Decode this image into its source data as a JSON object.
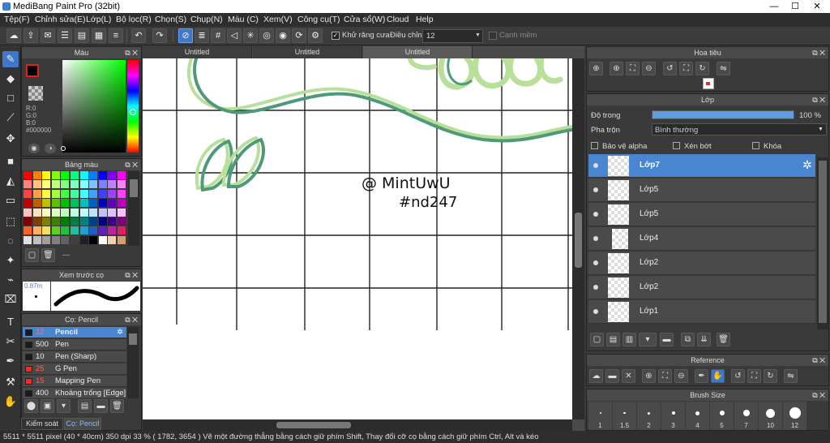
{
  "window": {
    "title": "MediBang Paint Pro (32bit)"
  },
  "menu": [
    "Tệp(F)",
    "Chỉnh sửa(E)",
    "Lớp(L)",
    "Bộ lọc(R)",
    "Chọn(S)",
    "Chụp(N)",
    "Màu (C)",
    "Xem(V)",
    "Công cụ(T)",
    "Cửa sổ(W)",
    "Cloud",
    "Help"
  ],
  "toolbar": {
    "antialias_label": "Khử răng cưa",
    "correction_label": "Điều chỉnh",
    "correction_value": "12",
    "smooth_label": "Cạnh mềm"
  },
  "color_panel": {
    "title": "Màu",
    "r": "R:0",
    "g": "G:0",
    "b": "B:0",
    "hex": "#000000"
  },
  "palette_panel": {
    "title": "Bảng màu",
    "footer": "---"
  },
  "preview_panel": {
    "title": "Xem trước cọ",
    "size": "0.87m"
  },
  "brush_panel": {
    "title": "Cọ: Pencil",
    "brushes": [
      {
        "size": "12",
        "name": "Pencil",
        "color": "#1a1a1a",
        "selected": true
      },
      {
        "size": "500",
        "name": "Pen",
        "color": "#1a1a1a",
        "selected": false
      },
      {
        "size": "10",
        "name": "Pen (Sharp)",
        "color": "#1a1a1a",
        "selected": false
      },
      {
        "size": "25",
        "name": "G Pen",
        "color": "#e03030",
        "selected": false
      },
      {
        "size": "15",
        "name": "Mapping Pen",
        "color": "#e03030",
        "selected": false
      },
      {
        "size": "400",
        "name": "Khoảng trống [Edge]",
        "color": "#1a1a1a",
        "selected": false
      }
    ],
    "tabs": [
      "Kiểm soát co",
      "Cọ: Pencil"
    ]
  },
  "canvas": {
    "tabs": [
      "Untitled",
      "Untitled",
      "Untitled"
    ],
    "watermark_line1": "@ MintUwU",
    "watermark_line2": "#nd247"
  },
  "navigator": {
    "title": "Hoa tiêu"
  },
  "layer_panel": {
    "title": "Lớp",
    "opacity_label": "Độ trong",
    "opacity_value": "100 %",
    "opacity_fraction": 1.0,
    "blend_label": "Pha trộn",
    "blend_value": "Bình thường",
    "protect_alpha": "Bảo vệ alpha",
    "clipping": "Xén bớt",
    "lock": "Khóa",
    "layers": [
      "Lớp7",
      "Lớp5",
      "Lớp5",
      "Lớp4",
      "Lớp2",
      "Lớp2",
      "Lớp1"
    ]
  },
  "reference_panel": {
    "title": "Reference"
  },
  "brush_size_panel": {
    "title": "Brush Size",
    "sizes": [
      "1",
      "1.5",
      "2",
      "3",
      "4",
      "5",
      "7",
      "10",
      "12"
    ]
  },
  "status": {
    "text": "5511 * 5511 pixel  (40 * 40cm)  350 dpi  33 %  ( 1782, 3654 )  Vẽ một đường thẳng bằng cách giữ phím Shift, Thay đổi cỡ cọ bằng cách giữ phím Ctrl, Alt và kéo"
  },
  "colors": {
    "accent": "#4a86d0",
    "line_dark": "#4e9a78",
    "line_light": "#b8e09a"
  }
}
